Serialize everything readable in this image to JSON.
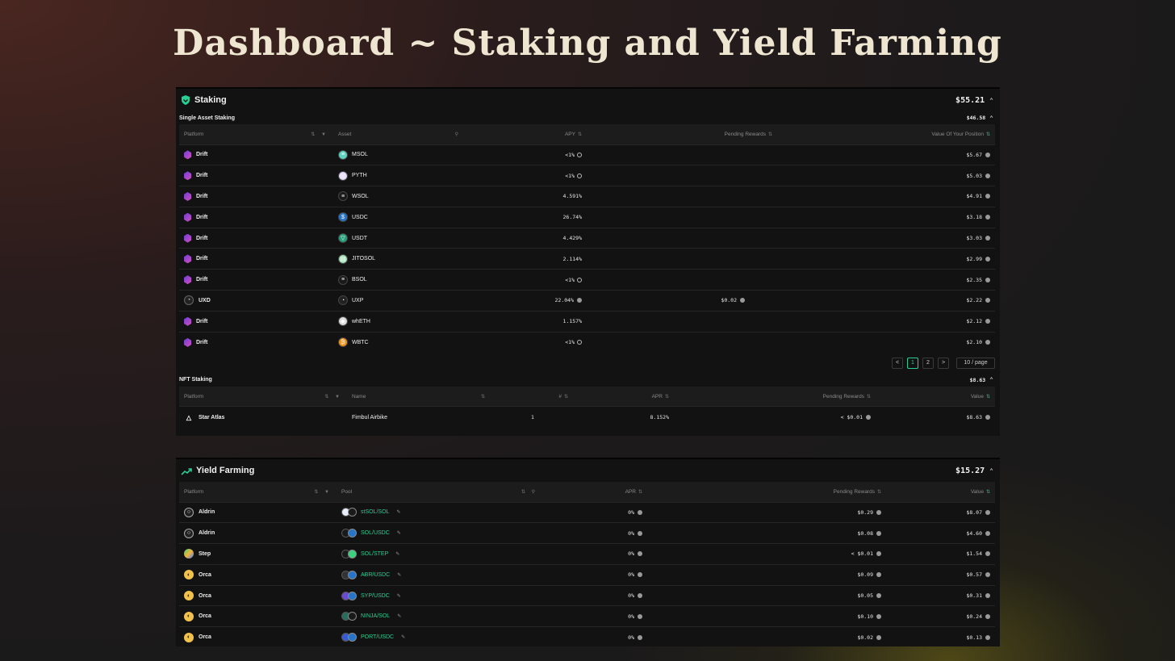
{
  "title": "Dashboard ~ Staking and Yield Farming",
  "accent": "#27d093",
  "staking": {
    "title": "Staking",
    "total": "$55.21",
    "single": {
      "title": "Single Asset Staking",
      "total": "$46.58",
      "headers": [
        "Platform",
        "Asset",
        "APY",
        "Pending Rewards",
        "Value Of Your Position"
      ],
      "rows": [
        {
          "platform": "Drift",
          "asset": "MSOL",
          "apy": "<1%",
          "rewards": "",
          "value": "$5.67"
        },
        {
          "platform": "Drift",
          "asset": "PYTH",
          "apy": "<1%",
          "rewards": "",
          "value": "$5.03"
        },
        {
          "platform": "Drift",
          "asset": "WSOL",
          "apy": "4.591%",
          "rewards": "",
          "value": "$4.91"
        },
        {
          "platform": "Drift",
          "asset": "USDC",
          "apy": "26.74%",
          "rewards": "",
          "value": "$3.18"
        },
        {
          "platform": "Drift",
          "asset": "USDT",
          "apy": "4.429%",
          "rewards": "",
          "value": "$3.03"
        },
        {
          "platform": "Drift",
          "asset": "JITOSOL",
          "apy": "2.114%",
          "rewards": "",
          "value": "$2.99"
        },
        {
          "platform": "Drift",
          "asset": "BSOL",
          "apy": "<1%",
          "rewards": "",
          "value": "$2.35"
        },
        {
          "platform": "UXD",
          "asset": "UXP",
          "apy": "22.04%",
          "rewards": "$0.02",
          "value": "$2.22"
        },
        {
          "platform": "Drift",
          "asset": "whETH",
          "apy": "1.157%",
          "rewards": "",
          "value": "$2.12"
        },
        {
          "platform": "Drift",
          "asset": "WBTC",
          "apy": "<1%",
          "rewards": "",
          "value": "$2.10"
        }
      ],
      "pager": {
        "prev": "<",
        "pages": [
          "1",
          "2"
        ],
        "next": ">",
        "size": "10 / page"
      }
    },
    "nft": {
      "title": "NFT Staking",
      "total": "$8.63",
      "headers": [
        "Platform",
        "Name",
        "#",
        "APR",
        "Pending Rewards",
        "Value"
      ],
      "rows": [
        {
          "platform": "Star Atlas",
          "name": "Fimbul Airbike",
          "count": "1",
          "apr": "8.152%",
          "rewards": "< $0.01",
          "value": "$8.63"
        }
      ]
    }
  },
  "yield": {
    "title": "Yield Farming",
    "total": "$15.27",
    "headers": [
      "Platform",
      "Pool",
      "APR",
      "Pending Rewards",
      "Value"
    ],
    "rows": [
      {
        "platform": "Aldrin",
        "pool": "stSOL/SOL",
        "apr": "0%",
        "rewards": "$0.29",
        "value": "$8.07"
      },
      {
        "platform": "Aldrin",
        "pool": "SOL/USDC",
        "apr": "0%",
        "rewards": "$0.08",
        "value": "$4.60"
      },
      {
        "platform": "Step",
        "pool": "SOL/STEP",
        "apr": "0%",
        "rewards": "< $0.01",
        "value": "$1.54"
      },
      {
        "platform": "Orca",
        "pool": "ABR/USDC",
        "apr": "0%",
        "rewards": "$0.09",
        "value": "$0.57"
      },
      {
        "platform": "Orca",
        "pool": "SYP/USDC",
        "apr": "0%",
        "rewards": "$0.05",
        "value": "$0.31"
      },
      {
        "platform": "Orca",
        "pool": "NINJA/SOL",
        "apr": "0%",
        "rewards": "$0.10",
        "value": "$0.24"
      },
      {
        "platform": "Orca",
        "pool": "PORT/USDC",
        "apr": "0%",
        "rewards": "$0.02",
        "value": "$0.13"
      }
    ]
  }
}
